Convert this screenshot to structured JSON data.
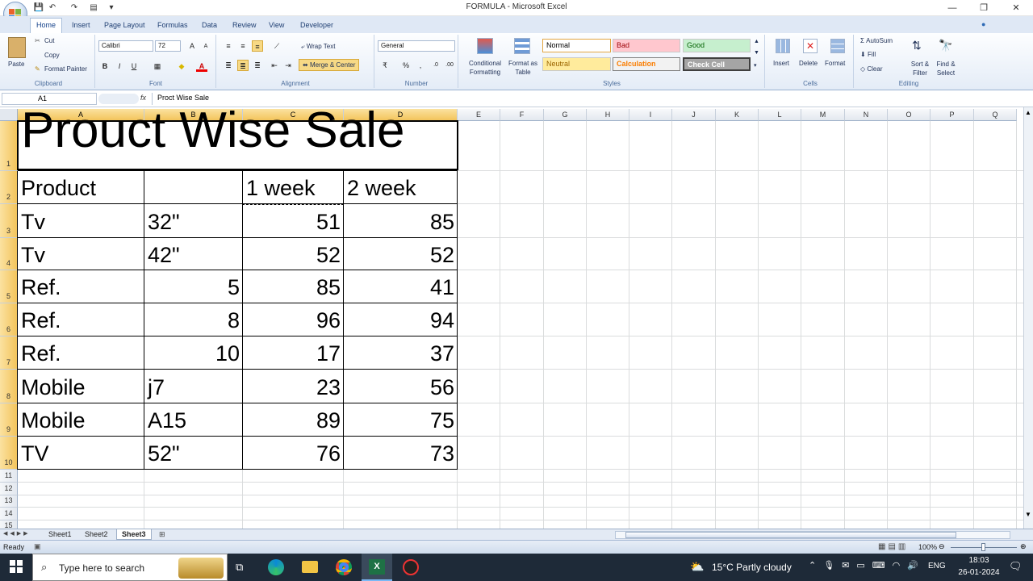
{
  "window": {
    "title": "FORMULA - Microsoft Excel",
    "minimize": "—",
    "restore": "❐",
    "close": "✕"
  },
  "tabs": [
    "Home",
    "Insert",
    "Page Layout",
    "Formulas",
    "Data",
    "Review",
    "View",
    "Developer"
  ],
  "ribbon": {
    "clipboard": {
      "paste": "Paste",
      "cut": "Cut",
      "copy": "Copy",
      "format_painter": "Format Painter",
      "label": "Clipboard"
    },
    "font": {
      "name": "Calibri",
      "size": "72",
      "bold": "B",
      "italic": "I",
      "underline": "U",
      "label": "Font",
      "grow": "A",
      "shrink": "A"
    },
    "alignment": {
      "wrap": "Wrap Text",
      "merge": "Merge & Center",
      "label": "Alignment"
    },
    "number": {
      "format": "General",
      "percent": "%",
      "comma": ",",
      "label": "Number"
    },
    "styles": {
      "cond_format": "Conditional Formatting",
      "format_table": "Format as Table",
      "normal": "Normal",
      "bad": "Bad",
      "good": "Good",
      "neutral": "Neutral",
      "calculation": "Calculation",
      "check_cell": "Check Cell",
      "label": "Styles"
    },
    "cells": {
      "insert": "Insert",
      "delete": "Delete",
      "format": "Format",
      "label": "Cells"
    },
    "editing": {
      "autosum": "AutoSum",
      "fill": "Fill",
      "clear": "Clear",
      "sort": "Sort & Filter",
      "find": "Find & Select",
      "label": "Editing"
    }
  },
  "formula_bar": {
    "name_box": "A1",
    "fx": "fx",
    "value": "Proct Wise Sale"
  },
  "columns": [
    "A",
    "B",
    "C",
    "D",
    "E",
    "F",
    "G",
    "H",
    "I",
    "J",
    "K",
    "L",
    "M",
    "N",
    "O",
    "P",
    "Q"
  ],
  "rows": [
    "1",
    "2",
    "3",
    "4",
    "5",
    "6",
    "7",
    "8",
    "9",
    "10",
    "11",
    "12",
    "13",
    "14",
    "15"
  ],
  "sheet": {
    "title": "Prouct Wise Sale",
    "headers": [
      "Product",
      "",
      "1 week",
      "2 week"
    ],
    "data": [
      [
        "Tv",
        "32\"",
        "51",
        "85"
      ],
      [
        "Tv",
        "42\"",
        "52",
        "52"
      ],
      [
        "Ref.",
        "5",
        "85",
        "41"
      ],
      [
        "Ref.",
        "8",
        "96",
        "94"
      ],
      [
        "Ref.",
        "10",
        "17",
        "37"
      ],
      [
        "Mobile",
        "j7",
        "23",
        "56"
      ],
      [
        "Mobile",
        "A15",
        "89",
        "75"
      ],
      [
        "TV",
        "52\"",
        "76",
        "73"
      ]
    ]
  },
  "sheet_tabs": [
    "Sheet1",
    "Sheet2",
    "Sheet3"
  ],
  "status": {
    "ready": "Ready",
    "zoom": "100%"
  },
  "taskbar": {
    "search": "Type here to search",
    "weather": "15°C  Partly cloudy",
    "lang": "ENG",
    "time": "18:03",
    "date": "26-01-2024"
  },
  "colors": {
    "accent": "#15428b",
    "selection": "#f3c45c",
    "taskbar": "#1e2a38"
  }
}
